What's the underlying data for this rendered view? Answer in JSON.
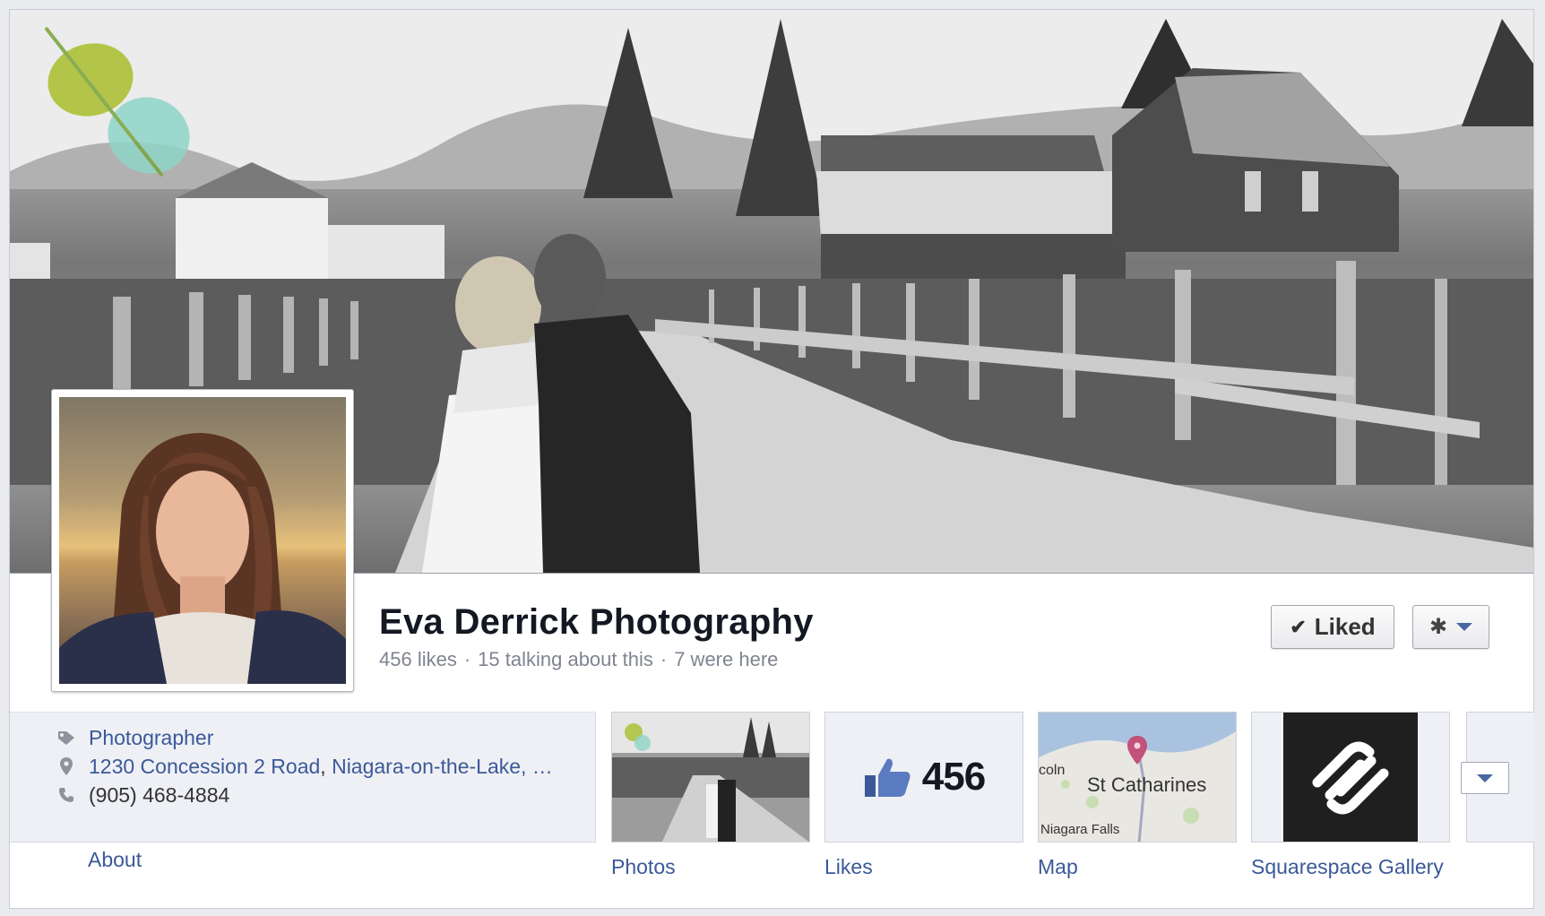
{
  "page": {
    "name": "Eva Derrick Photography",
    "likes": "456 likes",
    "talking": "15 talking about this",
    "were_here": "7 were here",
    "separator": "·"
  },
  "actions": {
    "liked_label": "Liked",
    "check_glyph": "✔",
    "gear_glyph": "✱"
  },
  "info": {
    "category": "Photographer",
    "address_street": "1230 Concession 2 Road",
    "address_city": "Niagara-on-the-Lake, …",
    "phone": "(905) 468-4884",
    "about_label": "About"
  },
  "apps": {
    "photos_label": "Photos",
    "likes_label": "Likes",
    "likes_count": "456",
    "map_label": "Map",
    "map_city": "St Catharines",
    "map_edge": "coln",
    "map_falls": "Niagara Falls",
    "squarespace_label": "Squarespace Gallery"
  },
  "icons": {
    "category": "tag-icon",
    "address": "map-pin-icon",
    "phone": "phone-icon",
    "likes": "thumbs-up-icon",
    "settings": "gear-icon",
    "more": "chevron-down-icon"
  },
  "colors": {
    "link": "#3b5998",
    "title": "#141823",
    "muted": "#808490",
    "info_bg": "#eef0f5"
  }
}
